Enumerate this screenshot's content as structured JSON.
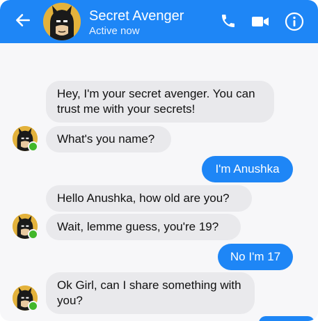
{
  "header": {
    "title": "Secret Avenger",
    "status": "Active now",
    "accent_color": "#1e86f6",
    "back_icon": "arrow-left-icon",
    "call_icon": "phone-icon",
    "video_icon": "video-camera-icon",
    "info_icon": "info-icon"
  },
  "messages": [
    {
      "sender": "them",
      "text": "Hey, I'm your secret avenger. You can trust me with your secrets!"
    },
    {
      "sender": "them",
      "text": "What's you name?"
    },
    {
      "sender": "me",
      "text": "I'm Anushka"
    },
    {
      "sender": "them",
      "text": "Hello Anushka, how old are you?"
    },
    {
      "sender": "them",
      "text": "Wait, lemme guess, you're 19?"
    },
    {
      "sender": "me",
      "text": "No I'm 17"
    },
    {
      "sender": "them",
      "text": "Ok Girl, can I share something with you?"
    }
  ],
  "colors": {
    "incoming_bubble": "#e9e9ec",
    "outgoing_bubble": "#1e86f6",
    "online_dot": "#42b72a"
  }
}
